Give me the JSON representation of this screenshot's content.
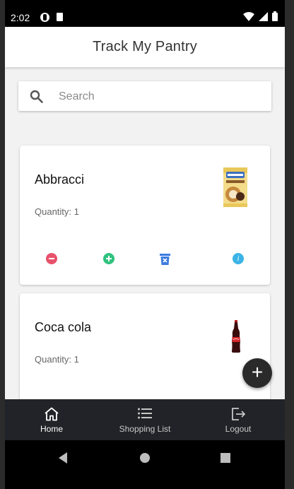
{
  "status_bar": {
    "time": "2:02"
  },
  "app_bar": {
    "title": "Track My Pantry"
  },
  "search": {
    "placeholder": "Search",
    "value": ""
  },
  "products": [
    {
      "name": "Abbracci",
      "quantity_label": "Quantity: 1",
      "image": "abbracci-package-image"
    },
    {
      "name": "Coca cola",
      "quantity_label": "Quantity: 1",
      "image": "coca-cola-bottle-image"
    }
  ],
  "actions": {
    "decrease": "minus-circle-icon",
    "increase": "plus-circle-icon",
    "delete": "trash-icon",
    "info": "info-icon"
  },
  "fab": {
    "icon": "plus-icon",
    "label": "+"
  },
  "bottom_nav": {
    "items": [
      {
        "label": "Home",
        "icon": "home-icon",
        "active": true
      },
      {
        "label": "Shopping List",
        "icon": "list-icon",
        "active": false
      },
      {
        "label": "Logout",
        "icon": "logout-icon",
        "active": false
      }
    ]
  },
  "colors": {
    "minus": "#e8516b",
    "plus": "#2ec27e",
    "trash": "#3d7be0",
    "info": "#3bb3e6",
    "nav_bg": "#222328",
    "fab_bg": "#2a2a2a"
  }
}
